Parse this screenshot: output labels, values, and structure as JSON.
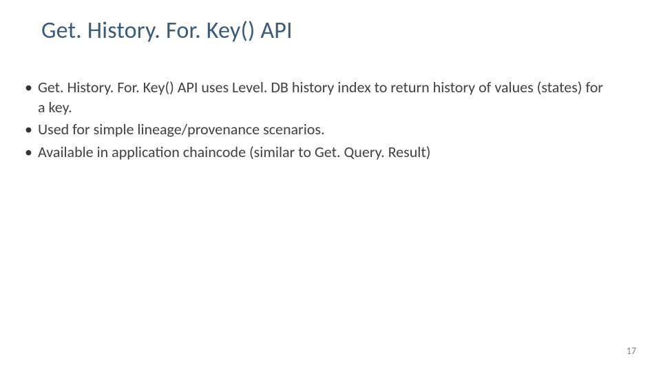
{
  "slide": {
    "title": "Get. History. For. Key() API",
    "bullets": [
      "Get. History. For. Key() API uses Level. DB history index to return history of values (states) for a key.",
      "Used for simple lineage/provenance scenarios.",
      "Available in application chaincode (similar to Get. Query. Result)"
    ],
    "page_number": "17"
  }
}
